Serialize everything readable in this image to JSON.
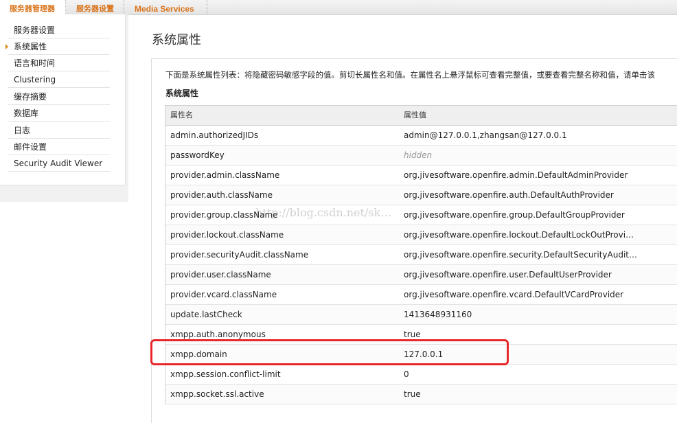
{
  "tabs": [
    {
      "label": "服务器管理器"
    },
    {
      "label": "服务器设置"
    },
    {
      "label": "Media Services"
    }
  ],
  "sidebar": {
    "items": [
      {
        "label": "服务器设置"
      },
      {
        "label": "系统属性"
      },
      {
        "label": "语言和时间"
      },
      {
        "label": "Clustering"
      },
      {
        "label": "缓存摘要"
      },
      {
        "label": "数据库"
      },
      {
        "label": "日志"
      },
      {
        "label": "邮件设置"
      },
      {
        "label": "Security Audit Viewer"
      }
    ],
    "active_index": 1
  },
  "main": {
    "title": "系统属性",
    "description": "下面是系统属性列表：将隐藏密码敏感字段的值。剪切长属性名和值。在属性名上悬浮鼠标可查看完整值，或要查看完整名称和值，请单击该",
    "section_title": "系统属性",
    "table": {
      "headers": [
        "属性名",
        "属性值"
      ],
      "rows": [
        {
          "name": "admin.authorizedJIDs",
          "value": "admin@127.0.0.1,zhangsan@127.0.0.1"
        },
        {
          "name": "passwordKey",
          "value": "hidden"
        },
        {
          "name": "provider.admin.className",
          "value": "org.jivesoftware.openfire.admin.DefaultAdminProvider"
        },
        {
          "name": "provider.auth.className",
          "value": "org.jivesoftware.openfire.auth.DefaultAuthProvider"
        },
        {
          "name": "provider.group.className",
          "value": "org.jivesoftware.openfire.group.DefaultGroupProvider"
        },
        {
          "name": "provider.lockout.className",
          "value": "org.jivesoftware.openfire.lockout.DefaultLockOutProvi…"
        },
        {
          "name": "provider.securityAudit.className",
          "value": "org.jivesoftware.openfire.security.DefaultSecurityAudit…"
        },
        {
          "name": "provider.user.className",
          "value": "org.jivesoftware.openfire.user.DefaultUserProvider"
        },
        {
          "name": "provider.vcard.className",
          "value": "org.jivesoftware.openfire.vcard.DefaultVCardProvider"
        },
        {
          "name": "update.lastCheck",
          "value": "1413648931160"
        },
        {
          "name": "xmpp.auth.anonymous",
          "value": "true"
        },
        {
          "name": "xmpp.domain",
          "value": "127.0.0.1"
        },
        {
          "name": "xmpp.session.conflict-limit",
          "value": "0"
        },
        {
          "name": "xmpp.socket.ssl.active",
          "value": "true"
        }
      ]
    }
  },
  "watermark": "http://blog.csdn.net/sk…",
  "colors": {
    "accent": "#d9731a",
    "highlight": "#e8262a"
  }
}
